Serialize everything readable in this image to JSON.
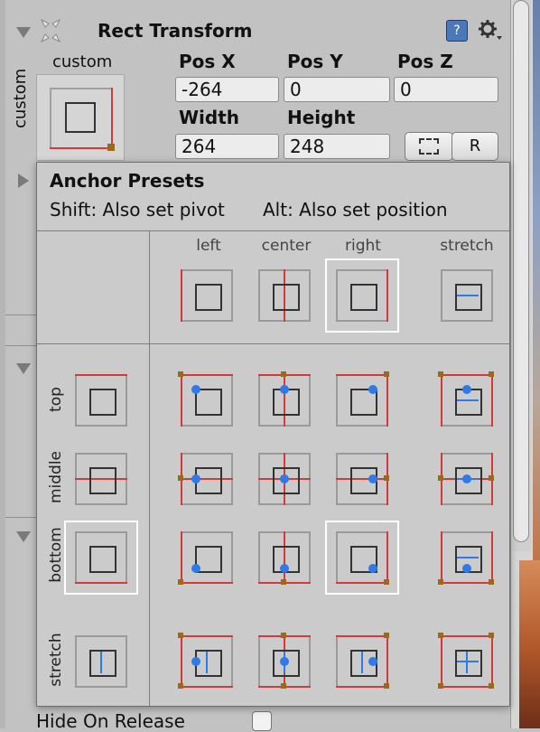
{
  "component": {
    "title": "Rect Transform",
    "anchor_label_top": "custom",
    "anchor_label_side": "custom",
    "help_icon": "help-book-icon",
    "settings_icon": "gear-icon",
    "drag_icon": "move-arrows-icon"
  },
  "fields": {
    "pos_x_label": "Pos X",
    "pos_y_label": "Pos Y",
    "pos_z_label": "Pos Z",
    "pos_x": "-264",
    "pos_y": "0",
    "pos_z": "0",
    "width_label": "Width",
    "height_label": "Height",
    "width": "264",
    "height": "248",
    "blueprint_button_icon": "dashed-rect-icon",
    "raw_button_label": "R"
  },
  "popup": {
    "title": "Anchor Presets",
    "shift_hint": "Shift: Also set pivot",
    "alt_hint": "Alt: Also set position",
    "columns": [
      "left",
      "center",
      "right",
      "stretch"
    ],
    "rows": [
      "top",
      "middle",
      "bottom",
      "stretch"
    ]
  },
  "below": {
    "hide_on_release_label": "Hide On Release"
  }
}
